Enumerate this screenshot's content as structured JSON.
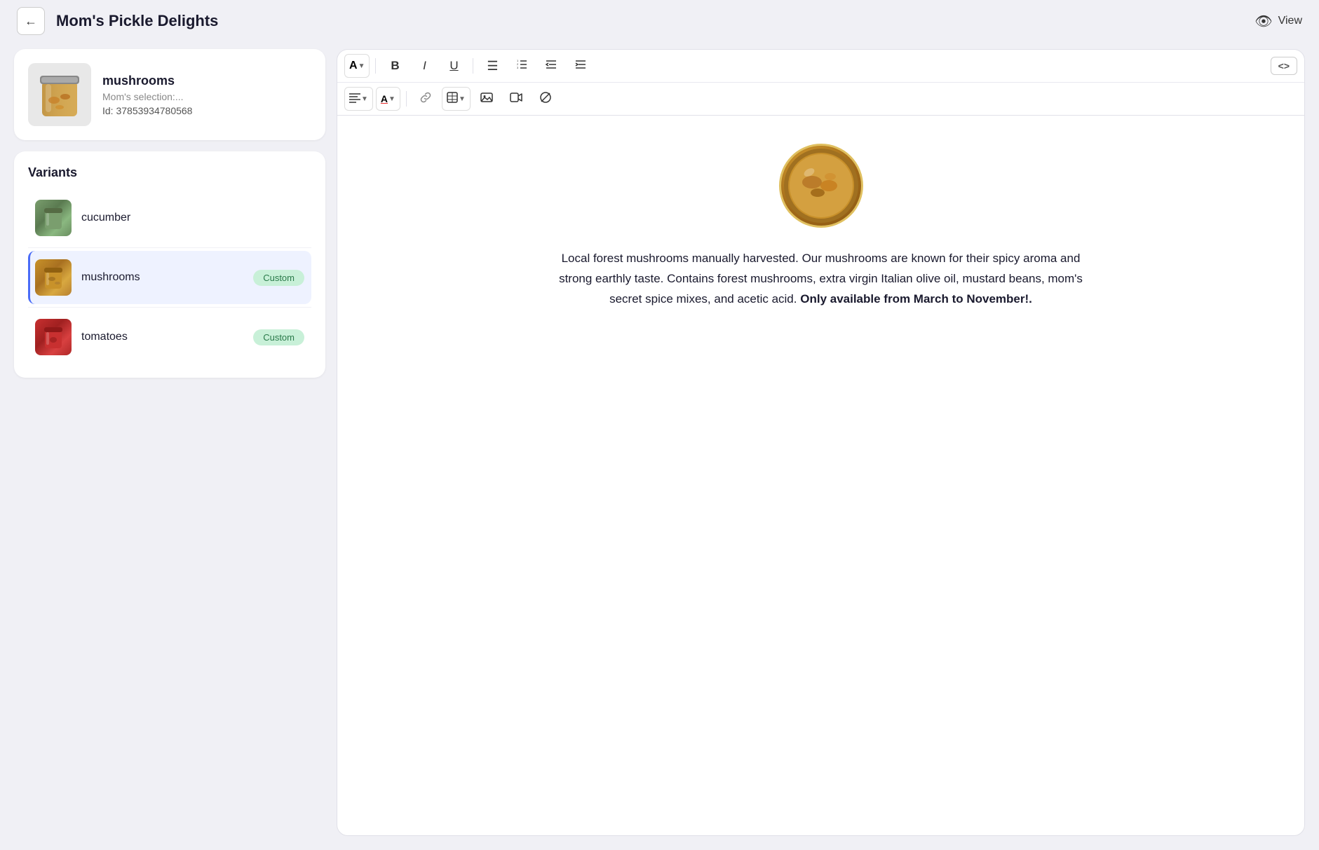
{
  "header": {
    "title": "Mom's Pickle Delights",
    "back_label": "←",
    "view_label": "View"
  },
  "product": {
    "name": "mushrooms",
    "subtitle": "Mom's selection:...",
    "id_label": "Id: 37853934780568"
  },
  "variants_section": {
    "title": "Variants",
    "items": [
      {
        "name": "cucumber",
        "badge": null,
        "active": false,
        "thumb_type": "cucumber"
      },
      {
        "name": "mushrooms",
        "badge": "Custom",
        "active": true,
        "thumb_type": "mushroom"
      },
      {
        "name": "tomatoes",
        "badge": "Custom",
        "active": false,
        "thumb_type": "tomato"
      }
    ]
  },
  "toolbar": {
    "row1": {
      "font_btn": "A",
      "bold_btn": "B",
      "italic_btn": "I",
      "underline_btn": "U",
      "ul_btn": "≡",
      "ol_btn": "≡",
      "indent_out_btn": "⇤",
      "indent_in_btn": "⇥",
      "code_btn": "<>"
    },
    "row2": {
      "align_btn": "≡",
      "color_btn": "A",
      "link_btn": "🔗",
      "table_btn": "⊞",
      "image_btn": "🖼",
      "video_btn": "📹",
      "block_btn": "⊘"
    }
  },
  "editor": {
    "description_text": "Local forest mushrooms manually harvested. Our mushrooms are known for their spicy aroma and strong earthly taste. Contains forest mushrooms, extra virgin Italian olive oil, mustard beans, mom's secret spice mixes, and acetic acid.",
    "description_bold": "Only available from March to November!.",
    "description_separator": " "
  }
}
